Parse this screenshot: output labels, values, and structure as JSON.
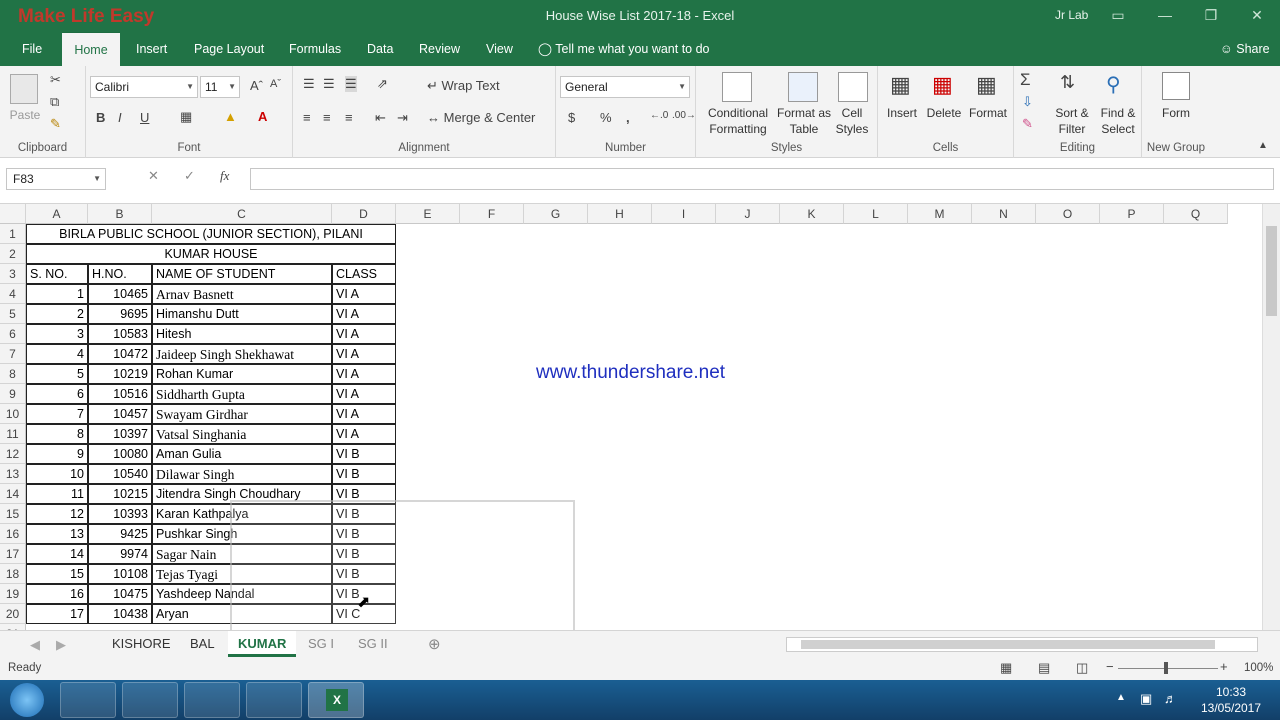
{
  "window": {
    "brand": "Make Life Easy",
    "title": "House Wise List 2017-18  -  Excel",
    "user": "Jr Lab"
  },
  "tabs": [
    "File",
    "Home",
    "Insert",
    "Page Layout",
    "Formulas",
    "Data",
    "Review",
    "View"
  ],
  "tell_me": "Tell me what you want to do",
  "share": "Share",
  "ribbon": {
    "clipboard": {
      "label": "Clipboard",
      "paste": "Paste"
    },
    "font": {
      "label": "Font",
      "name": "Calibri",
      "size": "11",
      "bold": "B",
      "italic": "I",
      "underline": "U"
    },
    "alignment": {
      "label": "Alignment",
      "wrap": "Wrap Text",
      "merge": "Merge & Center"
    },
    "number": {
      "label": "Number",
      "format": "General",
      "currency": "$",
      "percent": "%",
      "comma": ","
    },
    "styles": {
      "label": "Styles",
      "conditional_1": "Conditional",
      "conditional_2": "Formatting",
      "format_table_1": "Format as",
      "format_table_2": "Table",
      "cell_styles_1": "Cell",
      "cell_styles_2": "Styles"
    },
    "cells": {
      "label": "Cells",
      "insert": "Insert",
      "delete": "Delete",
      "format": "Format"
    },
    "editing": {
      "label": "Editing",
      "sort_1": "Sort &",
      "sort_2": "Filter",
      "find_1": "Find &",
      "find_2": "Select"
    },
    "newgroup": {
      "label": "New Group",
      "form": "Form"
    }
  },
  "formula_bar": {
    "name_box": "F83",
    "fx": "fx",
    "value": ""
  },
  "columns": [
    "A",
    "B",
    "C",
    "D",
    "E",
    "F",
    "G",
    "H",
    "I",
    "J",
    "K",
    "L",
    "M",
    "N",
    "O",
    "P",
    "Q"
  ],
  "sheet": {
    "title": "BIRLA PUBLIC SCHOOL (JUNIOR SECTION), PILANI",
    "house": "KUMAR  HOUSE",
    "headers": [
      "S. NO.",
      "H.NO.",
      "NAME OF STUDENT",
      "CLASS"
    ],
    "rows": [
      [
        "1",
        "10465",
        "Arnav Basnett",
        "VI A"
      ],
      [
        "2",
        "9695",
        "Himanshu Dutt",
        "VI A"
      ],
      [
        "3",
        "10583",
        "Hitesh",
        "VI A"
      ],
      [
        "4",
        "10472",
        "Jaideep Singh Shekhawat",
        "VI A"
      ],
      [
        "5",
        "10219",
        "Rohan Kumar",
        "VI A"
      ],
      [
        "6",
        "10516",
        "Siddharth Gupta",
        "VI A"
      ],
      [
        "7",
        "10457",
        "Swayam Girdhar",
        "VI A"
      ],
      [
        "8",
        "10397",
        "Vatsal Singhania",
        "VI A"
      ],
      [
        "9",
        "10080",
        "Aman Gulia",
        "VI B"
      ],
      [
        "10",
        "10540",
        "Dilawar Singh",
        "VI B"
      ],
      [
        "11",
        "10215",
        "Jitendra Singh Choudhary",
        "VI B"
      ],
      [
        "12",
        "10393",
        "Karan Kathpalya",
        "VI B"
      ],
      [
        "13",
        "9425",
        "Pushkar Singh",
        "VI B"
      ],
      [
        "14",
        "9974",
        "Sagar Nain",
        "VI B"
      ],
      [
        "15",
        "10108",
        "Tejas Tyagi",
        "VI B"
      ],
      [
        "16",
        "10475",
        "Yashdeep Nandal",
        "VI B"
      ],
      [
        "17",
        "10438",
        "Aryan",
        "VI C"
      ]
    ],
    "watermark": "www.thundershare.net"
  },
  "sheet_tabs": [
    "KISHORE",
    "BAL",
    "KUMAR",
    "SG I",
    "SG II"
  ],
  "active_sheet": "KUMAR",
  "status": {
    "ready": "Ready",
    "zoom": "100%"
  },
  "taskbar": {
    "time": "10:33",
    "date": "13/05/2017"
  }
}
